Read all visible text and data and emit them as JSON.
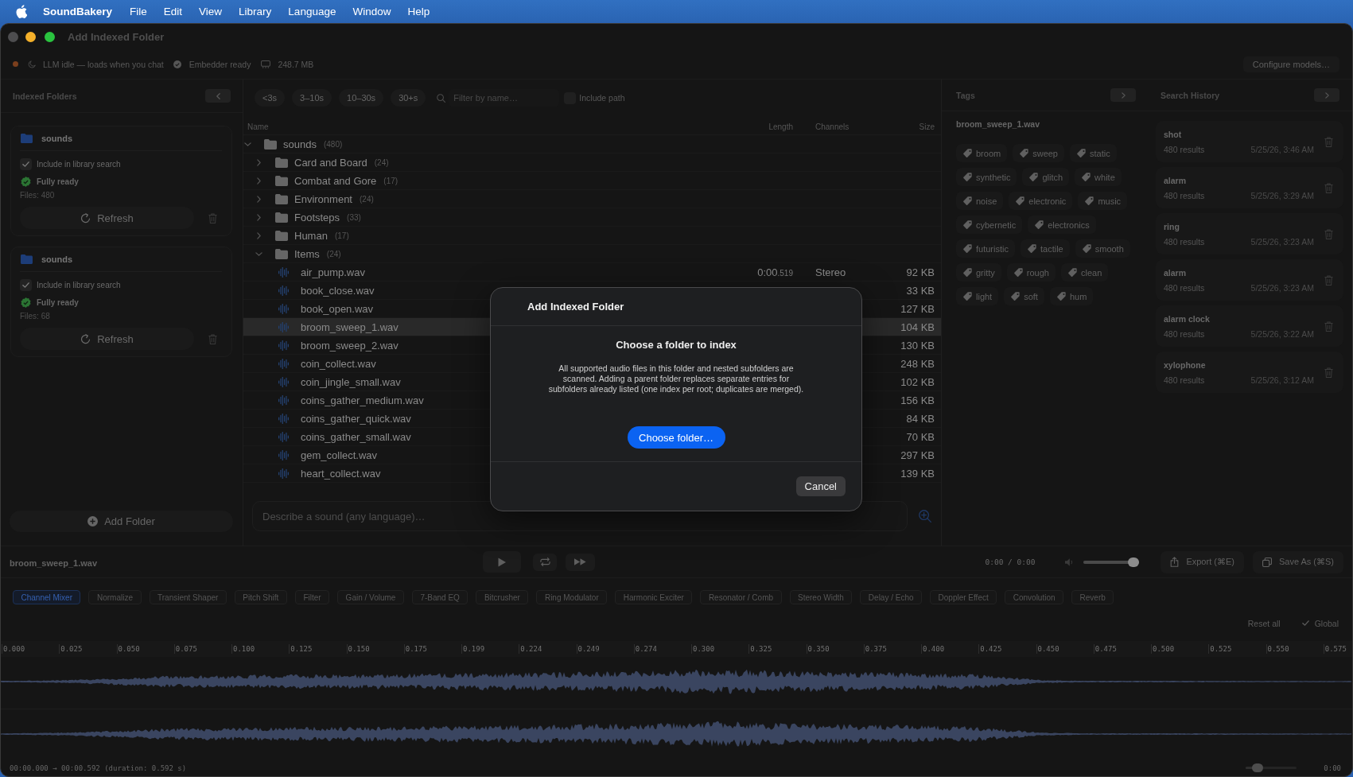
{
  "menu_bar": {
    "app_name": "SoundBakery",
    "items": [
      "File",
      "Edit",
      "View",
      "Library",
      "Language",
      "Window",
      "Help"
    ]
  },
  "window": {
    "title": "Add Indexed Folder"
  },
  "status_bar": {
    "llm": "LLM idle — loads when you chat",
    "embedder": "Embedder ready",
    "memory": "248.7 MB",
    "configure_button": "Configure models…"
  },
  "sidebar": {
    "title": "Indexed Folders",
    "folders": [
      {
        "name": "sounds",
        "include_label": "Include in library search",
        "include_checked": true,
        "status": "Fully ready",
        "files": "Files: 480",
        "refresh_button": "Refresh"
      },
      {
        "name": "sounds",
        "include_label": "Include in library search",
        "include_checked": true,
        "status": "Fully ready",
        "files": "Files: 68",
        "refresh_button": "Refresh"
      }
    ],
    "add_button": "Add Folder"
  },
  "browser": {
    "duration_filters": [
      {
        "label": "<3s",
        "selected": false
      },
      {
        "label": "3–10s",
        "selected": false
      },
      {
        "label": "10–30s",
        "selected": false
      },
      {
        "label": "30+s",
        "selected": false
      }
    ],
    "filter": {
      "placeholder": "Filter by name…"
    },
    "include_path": {
      "label": "Include path",
      "checked": false
    },
    "columns": [
      "Name",
      "Length",
      "Channels",
      "Size"
    ],
    "tree": [
      {
        "kind": "folder",
        "name": "sounds",
        "count": "(480)",
        "expanded": true,
        "selected": false,
        "children": [
          {
            "kind": "folder",
            "name": "Card and Board",
            "count": "(24)",
            "expanded": false,
            "selected": false
          },
          {
            "kind": "folder",
            "name": "Combat and Gore",
            "count": "(17)",
            "expanded": false,
            "selected": false
          },
          {
            "kind": "folder",
            "name": "Environment",
            "count": "(24)",
            "expanded": false,
            "selected": false
          },
          {
            "kind": "folder",
            "name": "Footsteps",
            "count": "(33)",
            "expanded": false,
            "selected": false
          },
          {
            "kind": "folder",
            "name": "Human",
            "count": "(17)",
            "expanded": false,
            "selected": false
          },
          {
            "kind": "folder",
            "name": "Items",
            "count": "(24)",
            "expanded": true,
            "selected": false,
            "children": [
              {
                "kind": "file",
                "name": "air_pump.wav",
                "length": "0:00",
                "length_fraction": ".519",
                "channels": "Stereo",
                "size": "92 KB",
                "selected": false
              },
              {
                "kind": "file",
                "name": "book_close.wav",
                "size": "33 KB",
                "selected": false
              },
              {
                "kind": "file",
                "name": "book_open.wav",
                "size": "127 KB",
                "selected": false
              },
              {
                "kind": "file",
                "name": "broom_sweep_1.wav",
                "size": "104 KB",
                "selected": true
              },
              {
                "kind": "file",
                "name": "broom_sweep_2.wav",
                "size": "130 KB",
                "selected": false
              },
              {
                "kind": "file",
                "name": "coin_collect.wav",
                "size": "248 KB",
                "selected": false
              },
              {
                "kind": "file",
                "name": "coin_jingle_small.wav",
                "size": "102 KB",
                "selected": false
              },
              {
                "kind": "file",
                "name": "coins_gather_medium.wav",
                "size": "156 KB",
                "selected": false
              },
              {
                "kind": "file",
                "name": "coins_gather_quick.wav",
                "size": "84 KB",
                "selected": false
              },
              {
                "kind": "file",
                "name": "coins_gather_small.wav",
                "size": "70 KB",
                "selected": false
              },
              {
                "kind": "file",
                "name": "gem_collect.wav",
                "size": "297 KB",
                "selected": false
              },
              {
                "kind": "file",
                "name": "heart_collect.wav",
                "size": "139 KB",
                "selected": false
              }
            ]
          }
        ]
      }
    ],
    "prompt": {
      "placeholder": "Describe a sound (any language)…"
    }
  },
  "tags_panel": {
    "title": "Tags",
    "file": "broom_sweep_1.wav",
    "tags": [
      "broom",
      "sweep",
      "static",
      "synthetic",
      "glitch",
      "white",
      "noise",
      "electronic",
      "music",
      "cybernetic",
      "electronics",
      "futuristic",
      "tactile",
      "smooth",
      "gritty",
      "rough",
      "clean",
      "light",
      "soft",
      "hum"
    ]
  },
  "search_history": {
    "title": "Search History",
    "entries": [
      {
        "query": "shot",
        "results": "480 results",
        "time": "5/25/26, 3:46 AM"
      },
      {
        "query": "alarm",
        "results": "480 results",
        "time": "5/25/26, 3:29 AM"
      },
      {
        "query": "ring",
        "results": "480 results",
        "time": "5/25/26, 3:23 AM"
      },
      {
        "query": "alarm",
        "results": "480 results",
        "time": "5/25/26, 3:23 AM"
      },
      {
        "query": "alarm clock",
        "results": "480 results",
        "time": "5/25/26, 3:22 AM"
      },
      {
        "query": "xylophone",
        "results": "480 results",
        "time": "5/25/26, 3:12 AM"
      }
    ]
  },
  "player": {
    "file": "broom_sweep_1.wav",
    "time": "0:00 / 0:00",
    "volume": {
      "level": 1.0
    },
    "export_button": "Export (⌘E)",
    "save_button": "Save As (⌘S)"
  },
  "effects": {
    "tabs": [
      {
        "label": "Channel Mixer",
        "selected": true
      },
      {
        "label": "Normalize",
        "selected": false
      },
      {
        "label": "Transient Shaper",
        "selected": false
      },
      {
        "label": "Pitch Shift",
        "selected": false
      },
      {
        "label": "Filter",
        "selected": false
      },
      {
        "label": "Gain / Volume",
        "selected": false
      },
      {
        "label": "7-Band EQ",
        "selected": false
      },
      {
        "label": "Bitcrusher",
        "selected": false
      },
      {
        "label": "Ring Modulator",
        "selected": false
      },
      {
        "label": "Harmonic Exciter",
        "selected": false
      },
      {
        "label": "Resonator / Comb",
        "selected": false
      },
      {
        "label": "Stereo Width",
        "selected": false
      },
      {
        "label": "Delay / Echo",
        "selected": false
      },
      {
        "label": "Doppler Effect",
        "selected": false
      },
      {
        "label": "Convolution",
        "selected": false
      },
      {
        "label": "Reverb",
        "selected": false
      }
    ],
    "reset_button": "Reset all",
    "global": {
      "label": "Global",
      "checked": true
    }
  },
  "timeline": {
    "ticks": [
      "0.000",
      "0.025",
      "0.050",
      "0.075",
      "0.100",
      "0.125",
      "0.150",
      "0.175",
      "0.199",
      "0.224",
      "0.249",
      "0.274",
      "0.300",
      "0.325",
      "0.350",
      "0.375",
      "0.400",
      "0.425",
      "0.450",
      "0.475",
      "0.500",
      "0.525",
      "0.550",
      "0.575"
    ],
    "selection": "00:00.000 → 00:00.592 (duration: 0.592 s)",
    "zoom": {
      "level": 0.15
    },
    "position": "0:00"
  },
  "dialog": {
    "title": "Add Indexed Folder",
    "heading": "Choose a folder to index",
    "body": "All supported audio files in this folder and nested subfolders are scanned. Adding a parent folder replaces separate entries for subfolders already listed (one index per root; duplicates are merged).",
    "primary_button": "Choose folder…",
    "cancel_button": "Cancel"
  }
}
